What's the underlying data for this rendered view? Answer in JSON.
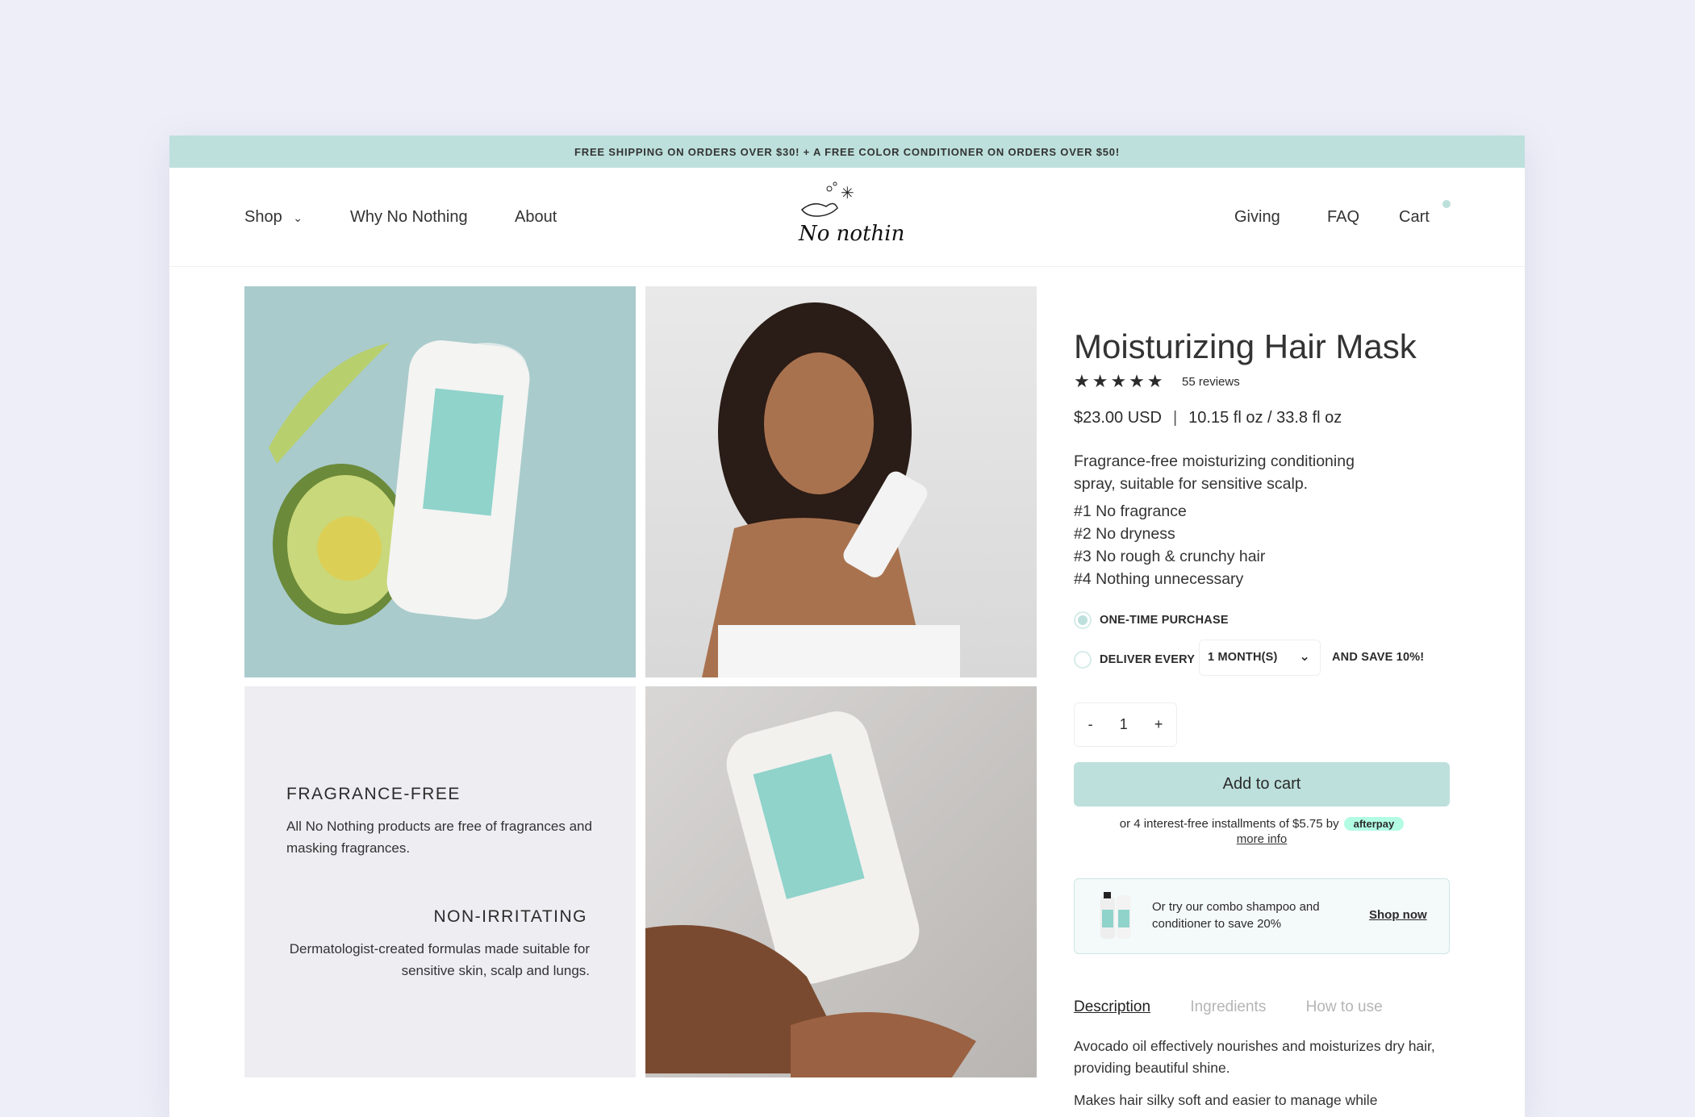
{
  "banner": "FREE SHIPPING ON ORDERS OVER $30! + A FREE COLOR CONDITIONER ON ORDERS OVER $50!",
  "nav": {
    "shop": "Shop",
    "why": "Why No Nothing",
    "about": "About",
    "giving": "Giving",
    "faq": "FAQ",
    "cart": "Cart",
    "logo": "No nothing"
  },
  "features": {
    "f1_title": "FRAGRANCE-FREE",
    "f1_text": "All No Nothing products are free of fragrances and masking fragrances.",
    "f2_title": "NON-IRRITATING",
    "f2_text": "Dermatologist-created formulas made suitable for sensitive skin, scalp and lungs."
  },
  "product": {
    "title": "Moisturizing Hair Mask",
    "rating": 5,
    "stars": "★★★★★",
    "reviews": "55 reviews",
    "price": "$23.00 USD",
    "size": "10.15 fl oz / 33.8 fl oz",
    "description": "Fragrance-free moisturizing conditioning spray, suitable for sensitive scalp.",
    "points": [
      "#1 No fragrance",
      "#2 No dryness",
      "#3 No rough & crunchy hair",
      "#4 Nothing unnecessary"
    ],
    "one_time": "ONE-TIME PURCHASE",
    "deliver": "DELIVER EVERY",
    "interval": "1 MONTH(S)",
    "save": "AND SAVE 10%!",
    "qty_minus": "-",
    "qty": "1",
    "qty_plus": "+",
    "add_to_cart": "Add to cart",
    "afterpay_text": "or 4 interest-free installments of $5.75 by",
    "afterpay_badge": "afterpay",
    "more_info": "more info",
    "combo_text": "Or try our combo shampoo and conditioner to save 20%",
    "shop_now": "Shop now",
    "tabs": [
      "Description",
      "Ingredients",
      "How to use"
    ],
    "desc1": "Avocado oil effectively nourishes and moisturizes dry hair, providing beautiful shine.",
    "desc2": "Makes hair silky soft and easier to manage while"
  },
  "colors": {
    "accent": "#bde0dc",
    "background": "#eeeef8",
    "afterpay": "#b2fce4"
  }
}
